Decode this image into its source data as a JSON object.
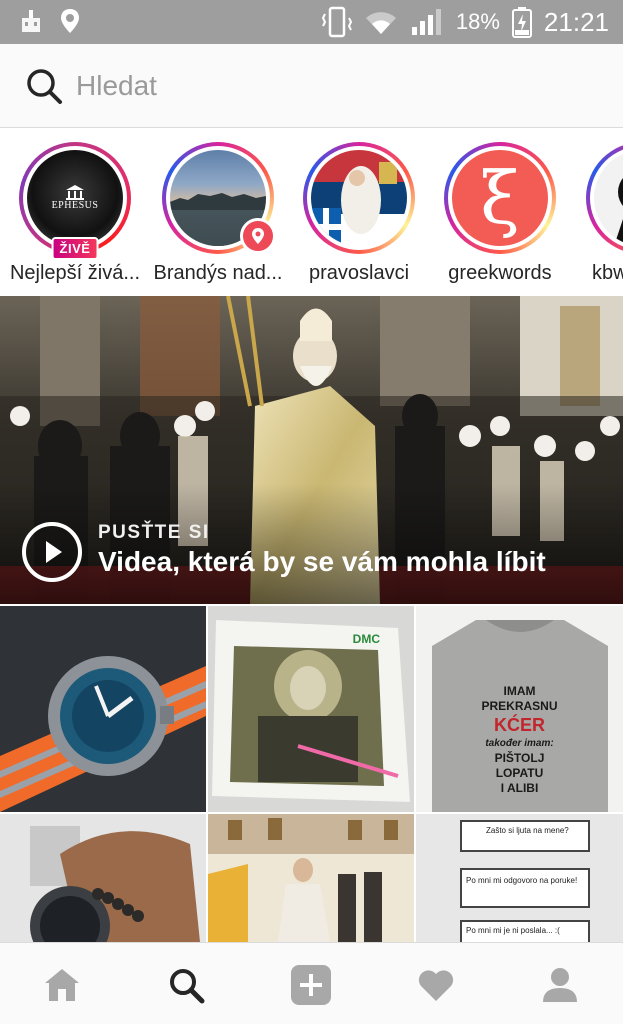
{
  "status_bar": {
    "battery_percent": "18%",
    "time": "21:21",
    "icons": [
      "app-notification-icon",
      "location-icon",
      "phone-vibrate-icon",
      "wifi-icon",
      "signal-icon",
      "battery-charging-icon"
    ]
  },
  "search": {
    "placeholder": "Hledat"
  },
  "stories": [
    {
      "label": "Nejlepší živá...",
      "badge": "ŽIVĚ",
      "avatar_text": "EPHESUS"
    },
    {
      "label": "Brandýs nad...",
      "badge_icon": "location-pin-icon"
    },
    {
      "label": "pravoslavci"
    },
    {
      "label": "greekwords",
      "avatar_text": "ξ"
    },
    {
      "label": "kbw"
    }
  ],
  "video_banner": {
    "kicker": "PUSŤTE SI",
    "title": "Videa, která by se vám mohla líbit"
  },
  "grid_tiles": [
    {
      "name": "watch-orange-strap"
    },
    {
      "name": "embroidery-icon-cloth",
      "text": "DMC"
    },
    {
      "name": "tshirt-print",
      "text": [
        "IMAM",
        "PREKRASNU",
        "KĆER",
        "također imam:",
        "PIŠTOLJ",
        "LOPATU",
        "I ALIBI"
      ]
    },
    {
      "name": "wrist-watch-bracelet"
    },
    {
      "name": "church-ceremony"
    },
    {
      "name": "comic-strip",
      "text": [
        "Zašto si ljuta na mene?",
        "Po mni mi odgovoro na poruke!",
        "Po mni mi je ni poslala... :("
      ]
    }
  ],
  "bottom_nav": [
    {
      "name": "home-icon"
    },
    {
      "name": "search-icon",
      "active": true
    },
    {
      "name": "add-post-icon"
    },
    {
      "name": "activity-heart-icon"
    },
    {
      "name": "profile-icon"
    }
  ],
  "colors": {
    "status_bar": "#9e9e9e",
    "search_bg": "#fafafa",
    "live_badge": "#e1306c",
    "location_badge": "#ed4956",
    "icon_gray": "#a8a8a8",
    "icon_active": "#262626"
  }
}
